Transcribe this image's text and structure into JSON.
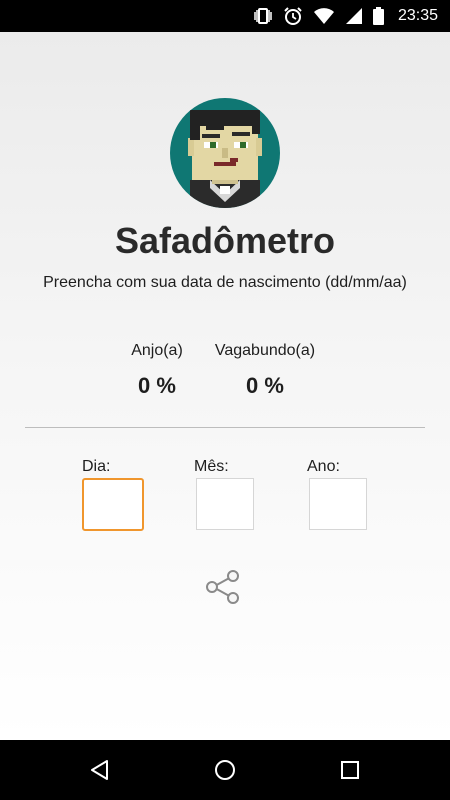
{
  "status_bar": {
    "time": "23:35",
    "icons": [
      "vibrate-icon",
      "alarm-icon",
      "wifi-icon",
      "signal-icon",
      "battery-icon"
    ]
  },
  "app": {
    "title": "Safadômetro",
    "subtitle": "Preencha com sua data de nascimento (dd/mm/aa)",
    "scores": {
      "anjo_label": "Anjo(a)",
      "anjo_value": "0 %",
      "vagabundo_label": "Vagabundo(a)",
      "vagabundo_value": "0 %"
    },
    "fields": {
      "dia_label": "Dia:",
      "dia_value": "",
      "mes_label": "Mês:",
      "mes_value": "",
      "ano_label": "Ano:",
      "ano_value": ""
    },
    "share_icon": "share-icon",
    "accent_color": "#f0962d",
    "avatar_bg": "#0f7773"
  },
  "nav_bar": {
    "icons": [
      "back-icon",
      "home-icon",
      "recents-icon"
    ]
  }
}
